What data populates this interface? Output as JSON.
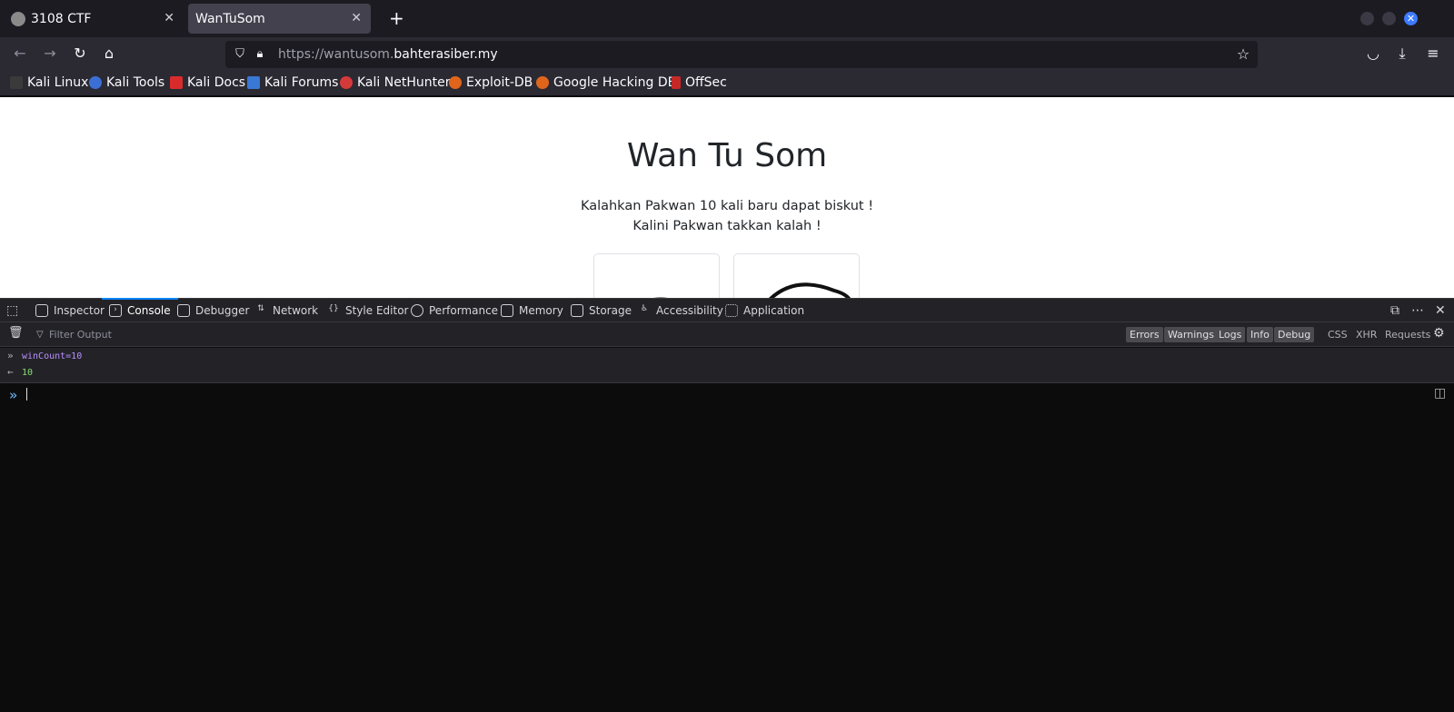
{
  "browser": {
    "tabs": [
      {
        "title": "3108 CTF",
        "active": false
      },
      {
        "title": "WanTuSom",
        "active": true
      }
    ],
    "new_tab_label": "+",
    "url": {
      "prefix": "https://wantusom.",
      "domain": "bahterasiber.my"
    },
    "bookmarks": [
      "Kali Linux",
      "Kali Tools",
      "Kali Docs",
      "Kali Forums",
      "Kali NetHunter",
      "Exploit-DB",
      "Google Hacking DB",
      "OffSec"
    ]
  },
  "page": {
    "title": "Wan Tu Som",
    "line1": "Kalahkan Pakwan 10 kali baru dapat biskut !",
    "line2": "Kalini Pakwan takkan kalah !"
  },
  "devtools": {
    "tabs": [
      "Inspector",
      "Console",
      "Debugger",
      "Network",
      "Style Editor",
      "Performance",
      "Memory",
      "Storage",
      "Accessibility",
      "Application"
    ],
    "active_tab": "Console",
    "filter_placeholder": "Filter Output",
    "levels": [
      "Errors",
      "Warnings",
      "Logs",
      "Info",
      "Debug"
    ],
    "extra_filters": [
      "CSS",
      "XHR",
      "Requests"
    ],
    "console": {
      "command": "winCount=10",
      "result": "10"
    }
  },
  "colors": {
    "accent": "#0a84ff",
    "page_bg": "#ffffff",
    "chrome_bg": "#2b2a33",
    "console_bg": "#0c0c0d"
  }
}
